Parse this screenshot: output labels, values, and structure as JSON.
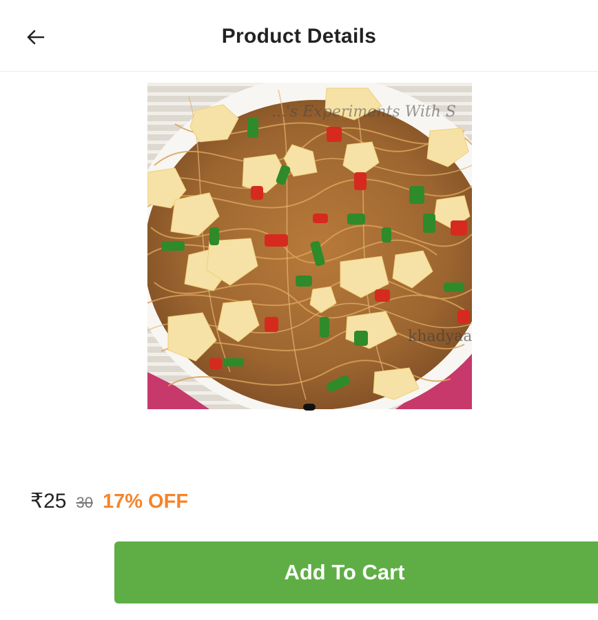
{
  "header": {
    "back_icon": "arrow-left-icon",
    "title": "Product Details"
  },
  "product": {
    "image_alt": "Egg hakka noodles with green onions and red peppers",
    "watermark_top": "...'s Experiments With S",
    "watermark_bottom": "khadyaa",
    "carousel_position": 1
  },
  "pricing": {
    "price": "₹25",
    "mrp": "30",
    "discount": "17% OFF",
    "discount_color": "#f5842a"
  },
  "actions": {
    "add_to_cart_label": "Add To Cart",
    "button_color": "#5fae45"
  }
}
